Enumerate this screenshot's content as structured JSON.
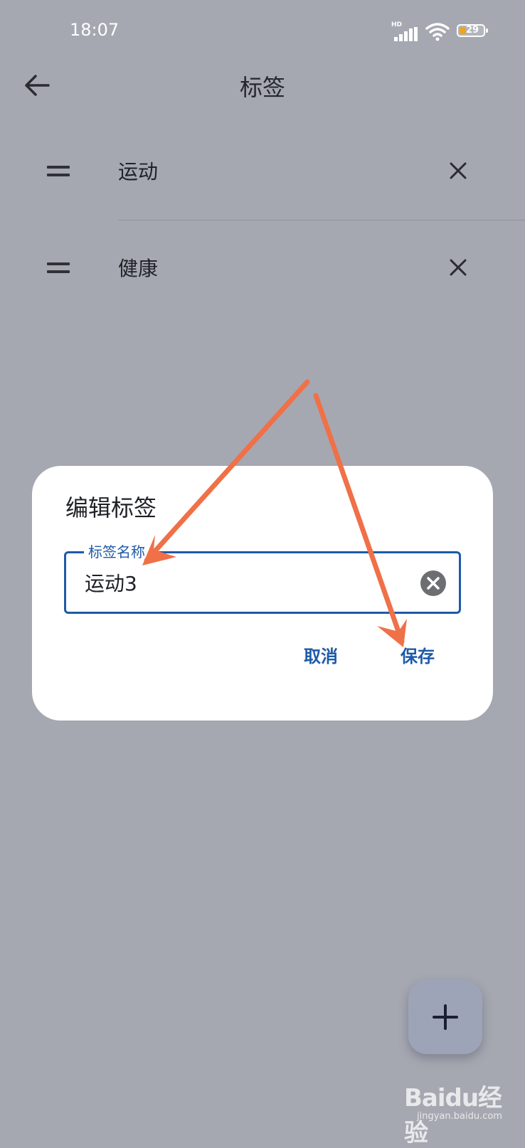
{
  "status_bar": {
    "time": "18:07",
    "network": "HD",
    "battery": "29"
  },
  "app_bar": {
    "title": "标签"
  },
  "tags": [
    {
      "label": "运动"
    },
    {
      "label": "健康"
    }
  ],
  "dialog": {
    "title": "编辑标签",
    "field_label": "标签名称",
    "field_value": "运动3",
    "cancel_label": "取消",
    "save_label": "保存"
  },
  "fab": {
    "icon": "plus-icon"
  },
  "annotation_color": "#f07048",
  "watermark": {
    "text": "Baidu经验",
    "sub": "jingyan.baidu.com"
  }
}
